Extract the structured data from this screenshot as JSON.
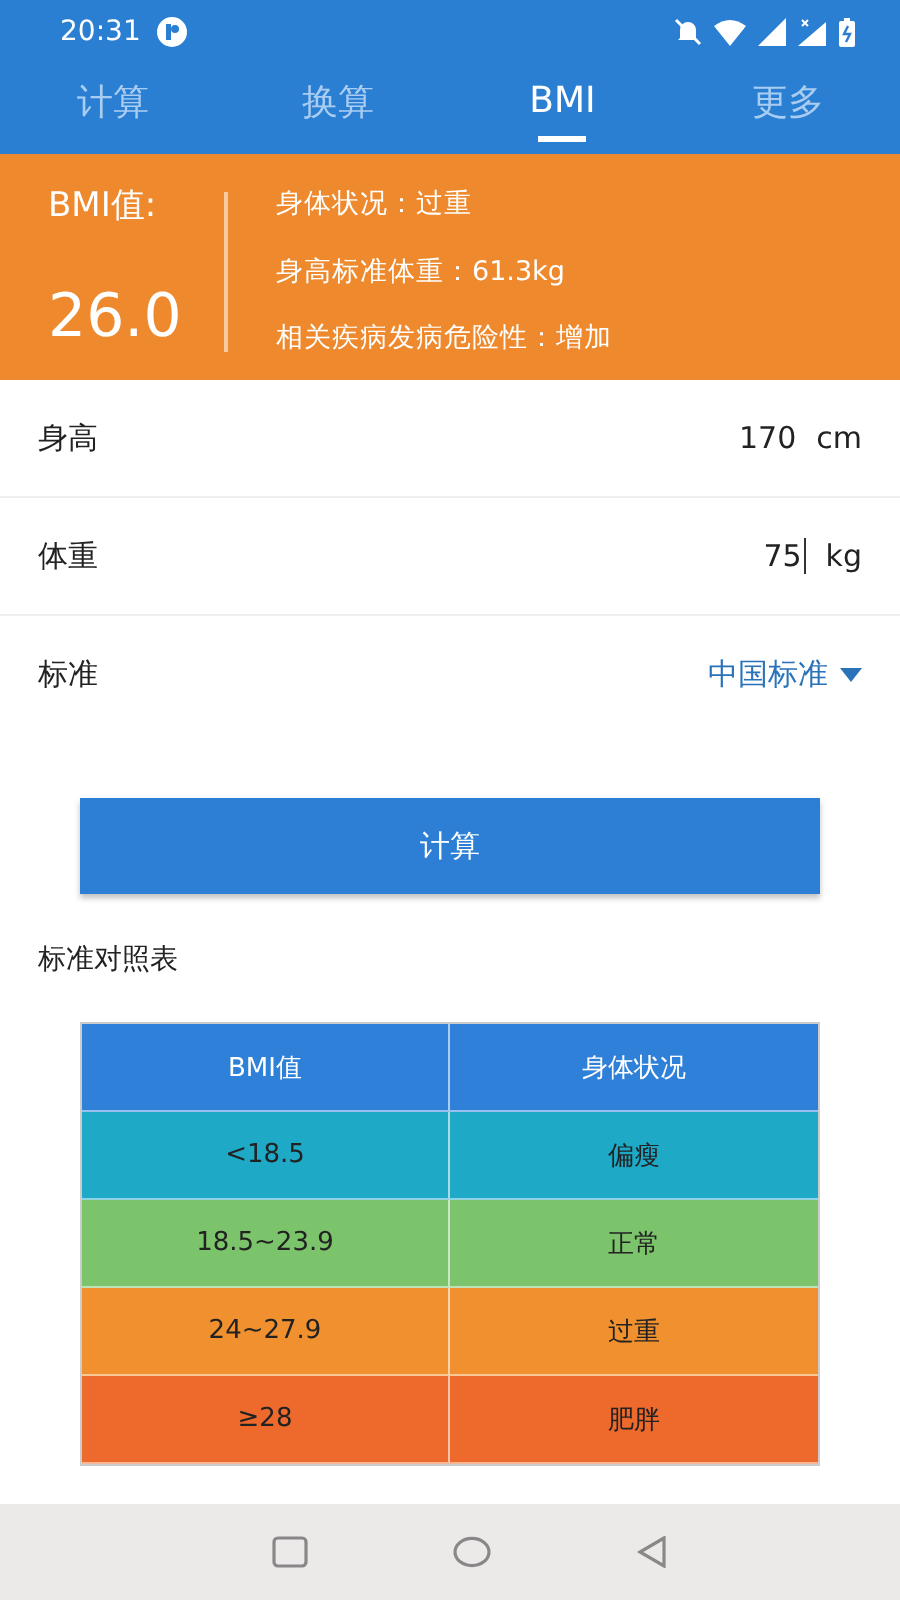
{
  "status_bar": {
    "time": "20:31"
  },
  "tabs": [
    {
      "label": "计算",
      "selected": false
    },
    {
      "label": "换算",
      "selected": false
    },
    {
      "label": "BMI",
      "selected": true
    },
    {
      "label": "更多",
      "selected": false
    }
  ],
  "result": {
    "label": "BMI值:",
    "value": "26.0",
    "details": [
      "身体状况：过重",
      "身高标准体重：61.3kg",
      "相关疾病发病危险性：增加"
    ]
  },
  "fields": [
    {
      "kind": "input",
      "label": "身高",
      "value": "170",
      "unit": "cm",
      "focused": false
    },
    {
      "kind": "input",
      "label": "体重",
      "value": "75",
      "unit": "kg",
      "focused": true
    },
    {
      "kind": "select",
      "label": "标准",
      "value": "中国标准"
    }
  ],
  "calculate_button": "计算",
  "table_title": "标准对照表",
  "table": {
    "columns": [
      "BMI值",
      "身体状况"
    ],
    "rows": [
      {
        "cells": [
          "<18.5",
          "偏瘦"
        ],
        "color": "#1ea9c6"
      },
      {
        "cells": [
          "18.5~23.9",
          "正常"
        ],
        "color": "#7cc46b"
      },
      {
        "cells": [
          "24~27.9",
          "过重"
        ],
        "color": "#f0902f"
      },
      {
        "cells": [
          "≥28",
          "肥胖"
        ],
        "color": "#ee6a2c"
      }
    ]
  }
}
